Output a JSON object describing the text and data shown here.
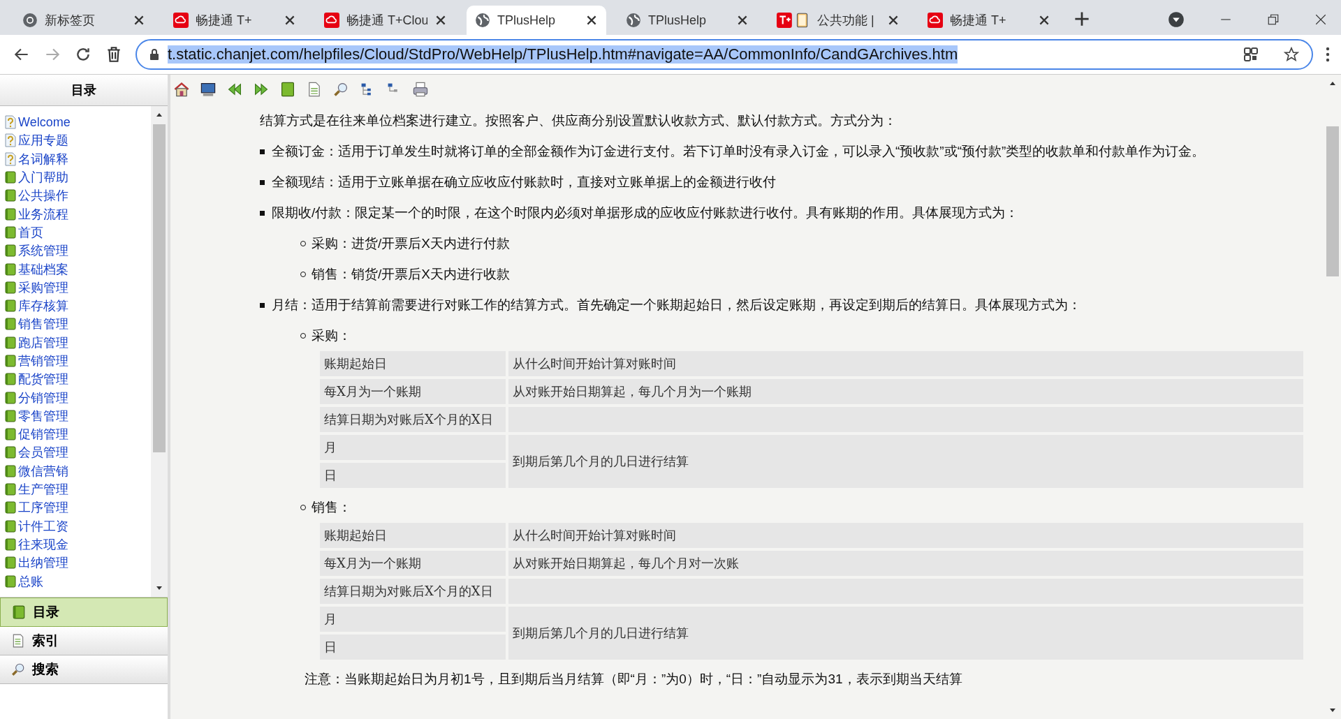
{
  "browser": {
    "tabs": [
      {
        "title": "新标签页",
        "kind": "chrome",
        "selected": false
      },
      {
        "title": "畅捷通 T+",
        "kind": "cloud",
        "selected": false
      },
      {
        "title": "畅捷通 T+Clou",
        "kind": "cloud",
        "selected": false
      },
      {
        "title": "TPlusHelp",
        "kind": "globe",
        "selected": true
      },
      {
        "title": "TPlusHelp",
        "kind": "globe",
        "selected": false
      },
      {
        "title": "公共功能 |",
        "kind": "tplus-book",
        "selected": false
      },
      {
        "title": "畅捷通 T+",
        "kind": "cloud",
        "selected": false
      }
    ],
    "address": "t.static.chanjet.com/helpfiles/Cloud/StdPro/WebHelp/TPlusHelp.htm#navigate=AA/CommonInfo/CandGArchives.htm"
  },
  "help": {
    "toc_header": "目录",
    "tree": [
      {
        "label": "Welcome",
        "kind": "page"
      },
      {
        "label": "应用专题",
        "kind": "page"
      },
      {
        "label": "名词解释",
        "kind": "page"
      },
      {
        "label": "入门帮助",
        "kind": "book"
      },
      {
        "label": "公共操作",
        "kind": "book"
      },
      {
        "label": "业务流程",
        "kind": "book"
      },
      {
        "label": "首页",
        "kind": "book"
      },
      {
        "label": "系统管理",
        "kind": "book"
      },
      {
        "label": "基础档案",
        "kind": "book"
      },
      {
        "label": "采购管理",
        "kind": "book"
      },
      {
        "label": "库存核算",
        "kind": "book"
      },
      {
        "label": "销售管理",
        "kind": "book"
      },
      {
        "label": "跑店管理",
        "kind": "book"
      },
      {
        "label": "营销管理",
        "kind": "book"
      },
      {
        "label": "配货管理",
        "kind": "book"
      },
      {
        "label": "分销管理",
        "kind": "book"
      },
      {
        "label": "零售管理",
        "kind": "book"
      },
      {
        "label": "促销管理",
        "kind": "book"
      },
      {
        "label": "会员管理",
        "kind": "book"
      },
      {
        "label": "微信营销",
        "kind": "book"
      },
      {
        "label": "生产管理",
        "kind": "book"
      },
      {
        "label": "工序管理",
        "kind": "book"
      },
      {
        "label": "计件工资",
        "kind": "book"
      },
      {
        "label": "往来现金",
        "kind": "book"
      },
      {
        "label": "出纳管理",
        "kind": "book"
      },
      {
        "label": "总账",
        "kind": "book"
      }
    ],
    "panel_tabs": [
      {
        "label": "目录",
        "kind": "book",
        "selected": true
      },
      {
        "label": "索引",
        "kind": "doc",
        "selected": false
      },
      {
        "label": "搜索",
        "kind": "search",
        "selected": false
      }
    ]
  },
  "content": {
    "intro": "结算方式是在往来单位档案进行建立。按照客户、供应商分别设置默认收款方式、默认付款方式。方式分为：",
    "items": [
      {
        "text": "全额订金：适用于订单发生时就将订单的全部金额作为订金进行支付。若下订单时没有录入订金，可以录入“预收款”或“预付款”类型的收款单和付款单作为订金。"
      },
      {
        "text": "全额现结：适用于立账单据在确立应收应付账款时，直接对立账单据上的金额进行收付"
      },
      {
        "text": "限期收/付款：限定某一个的时限，在这个时限内必须对单据形成的应收应付账款进行收付。具有账期的作用。具体展现方式为：",
        "children": [
          {
            "text": "采购：进货/开票后X天内进行付款"
          },
          {
            "text": "销售：销货/开票后X天内进行收款"
          }
        ]
      },
      {
        "text": "月结：适用于结算前需要进行对账工作的结算方式。首先确定一个账期起始日，然后设定账期，再设定到期后的结算日。具体展现方式为：",
        "children": [
          {
            "text": "采购：",
            "table": {
              "rows": [
                [
                  "账期起始日",
                  "从什么时间开始计算对账时间"
                ],
                [
                  "每X月为一个账期",
                  "从对账开始日期算起，每几个月为一个账期"
                ],
                [
                  "结算日期为对账后X个月的X日"
                ]
              ],
              "merged": {
                "labels": [
                  "月",
                  "日"
                ],
                "desc": "到期后第几个月的几日进行结算"
              }
            }
          },
          {
            "text": "销售：",
            "table": {
              "rows": [
                [
                  "账期起始日",
                  "从什么时间开始计算对账时间"
                ],
                [
                  "每X月为一个账期",
                  "从对账开始日期算起，每几个月对一次账"
                ],
                [
                  "结算日期为对账后X个月的X日"
                ]
              ],
              "merged": {
                "labels": [
                  "月",
                  "日"
                ],
                "desc": "到期后第几个月的几日进行结算"
              }
            }
          }
        ]
      }
    ],
    "note": "注意：当账期起始日为月初1号，且到期后当月结算（即“月：”为0）时，“日：”自动显示为31，表示到期当天结算"
  }
}
